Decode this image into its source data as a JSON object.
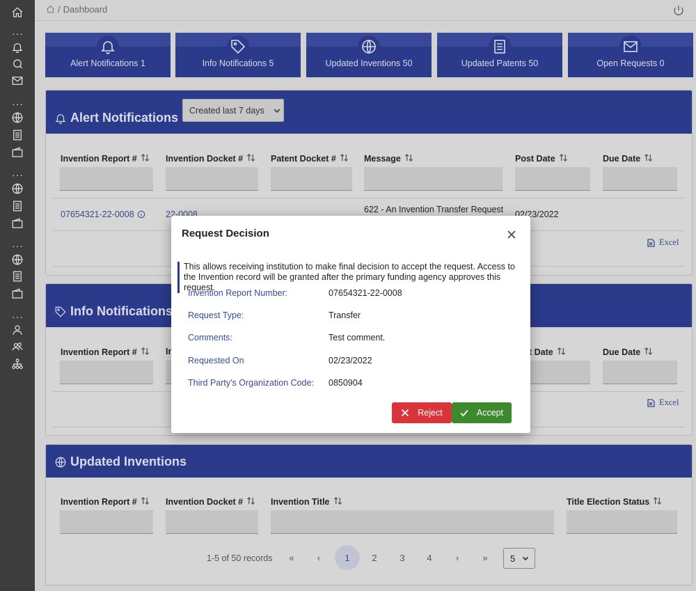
{
  "breadcrumb": {
    "current": "Dashboard"
  },
  "tiles": [
    {
      "label": "Alert Notifications 1",
      "icon": "bell-icon"
    },
    {
      "label": "Info Notifications 5",
      "icon": "tag-icon"
    },
    {
      "label": "Updated Inventions 50",
      "icon": "globe-icon"
    },
    {
      "label": "Updated Patents 50",
      "icon": "document-icon"
    },
    {
      "label": "Open Requests 0",
      "icon": "mail-icon"
    }
  ],
  "alert_panel": {
    "title": "Alert Notifications",
    "filter_dropdown": "Created last 7 days",
    "columns": [
      "Invention Report #",
      "Invention Docket #",
      "Patent Docket #",
      "Message",
      "Post Date",
      "Due Date"
    ],
    "row": {
      "invention_report": "07654321-22-0008",
      "invention_docket": "22-0008",
      "message": "622 - An Invention Transfer Request",
      "post_date": "02/23/2022"
    },
    "export_label": "Excel"
  },
  "info_panel": {
    "title": "Info Notifications",
    "columns": [
      "Invention Report #",
      "In",
      "st Date",
      "Due Date"
    ],
    "export_label": "Excel"
  },
  "inventions_panel": {
    "title": "Updated Inventions",
    "columns": [
      "Invention Report #",
      "Invention Docket #",
      "Invention Title",
      "Title Election Status"
    ],
    "pager": {
      "records_label": "1-5 of 50 records",
      "first": "«",
      "prev": "‹",
      "pages": [
        "1",
        "2",
        "3",
        "4"
      ],
      "next": "›",
      "last": "»",
      "per_page": "5"
    }
  },
  "modal": {
    "title": "Request Decision",
    "description": "This allows receiving institution to make final decision to accept the request. Access to the Invention record will be granted after the primary funding agency approves this request.",
    "fields": [
      {
        "label": "Invention Report Number:",
        "value": "07654321-22-0008"
      },
      {
        "label": "Request Type:",
        "value": "Transfer"
      },
      {
        "label": "Comments:",
        "value": "Test comment."
      },
      {
        "label": "Requested On",
        "value": "02/23/2022"
      },
      {
        "label": "Third Party's Organization Code:",
        "value": "0850904"
      }
    ],
    "reject_label": "Reject",
    "accept_label": "Accept"
  }
}
